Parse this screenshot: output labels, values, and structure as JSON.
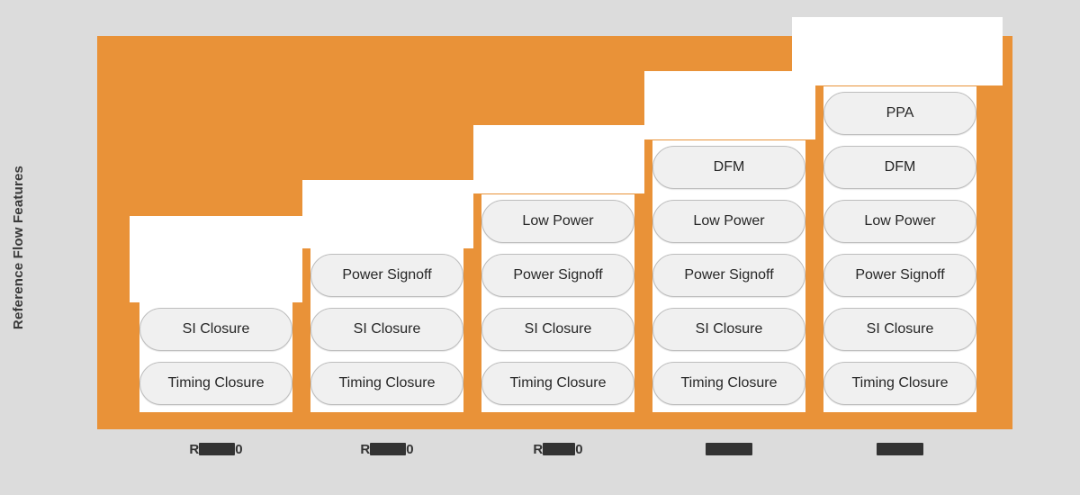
{
  "chart_data": {
    "type": "bar",
    "title": "",
    "subtitle": "",
    "xlabel": "",
    "ylabel": "Reference Flow Features",
    "legend": [],
    "grid": false,
    "orientation": "vertical",
    "description": "Cumulative staircase bar chart: each successive release adds one more reference-flow feature pill on top of the previous release's stack.",
    "categories": [
      "R███0",
      "R███0",
      "R███0",
      "█████",
      "█████"
    ],
    "category_notes": [
      "partially redacted: starts with R, ends with 0",
      "partially redacted: starts with R, ends with 0",
      "partially redacted: starts with R, ends with 0",
      "fully redacted",
      "fully redacted"
    ],
    "values": [
      2,
      3,
      4,
      5,
      6
    ],
    "ylim": [
      0,
      7
    ],
    "feature_order_bottom_up": [
      "Timing Closure",
      "SI Closure",
      "Power Signoff",
      "Low Power",
      "DFM",
      "PPA"
    ],
    "series": [
      {
        "name": "R███0",
        "count": 2,
        "features_bottom_up": [
          "Timing Closure",
          "SI Closure"
        ]
      },
      {
        "name": "R███0",
        "count": 3,
        "features_bottom_up": [
          "Timing Closure",
          "SI Closure",
          "Power Signoff"
        ]
      },
      {
        "name": "R███0",
        "count": 4,
        "features_bottom_up": [
          "Timing Closure",
          "SI Closure",
          "Power Signoff",
          "Low Power"
        ]
      },
      {
        "name": "█████",
        "count": 5,
        "features_bottom_up": [
          "Timing Closure",
          "SI Closure",
          "Power Signoff",
          "Low Power",
          "DFM"
        ]
      },
      {
        "name": "█████",
        "count": 6,
        "features_bottom_up": [
          "Timing Closure",
          "SI Closure",
          "Power Signoff",
          "Low Power",
          "DFM",
          "PPA"
        ]
      }
    ],
    "colors": {
      "panel_background": "#e99238",
      "page_background": "#dcdcdc",
      "step_block": "#ffffff",
      "pill_fill": "#f0f0f0",
      "pill_border": "#bdbdbd",
      "text": "#262626",
      "axis_label": "#3a3a3a",
      "redaction": "#333333"
    }
  },
  "axis": {
    "y_title": "Reference Flow Features"
  },
  "columns": [
    {
      "id": "col-1",
      "tick_prefix": "R",
      "tick_suffix": "0",
      "tick_redacted": true,
      "pills": [
        {
          "label": "SI Closure"
        },
        {
          "label": "Timing Closure"
        }
      ]
    },
    {
      "id": "col-2",
      "tick_prefix": "R",
      "tick_suffix": "0",
      "tick_redacted": true,
      "pills": [
        {
          "label": "Power Signoff"
        },
        {
          "label": "SI Closure"
        },
        {
          "label": "Timing Closure"
        }
      ]
    },
    {
      "id": "col-3",
      "tick_prefix": "R",
      "tick_suffix": "0",
      "tick_redacted": true,
      "pills": [
        {
          "label": "Low Power"
        },
        {
          "label": "Power Signoff"
        },
        {
          "label": "SI Closure"
        },
        {
          "label": "Timing Closure"
        }
      ]
    },
    {
      "id": "col-4",
      "tick_prefix": "",
      "tick_suffix": "",
      "tick_redacted": true,
      "pills": [
        {
          "label": "DFM"
        },
        {
          "label": "Low Power"
        },
        {
          "label": "Power Signoff"
        },
        {
          "label": "SI Closure"
        },
        {
          "label": "Timing Closure"
        }
      ]
    },
    {
      "id": "col-5",
      "tick_prefix": "",
      "tick_suffix": "",
      "tick_redacted": true,
      "pills": [
        {
          "label": "PPA"
        },
        {
          "label": "DFM"
        },
        {
          "label": "Low Power"
        },
        {
          "label": "Power Signoff"
        },
        {
          "label": "SI Closure"
        },
        {
          "label": "Timing Closure"
        }
      ]
    }
  ],
  "pill_labels": {
    "timing_closure": "Timing Closure",
    "si_closure": "SI Closure",
    "power_signoff": "Power Signoff",
    "low_power": "Low Power",
    "dfm": "DFM",
    "ppa": "PPA"
  }
}
